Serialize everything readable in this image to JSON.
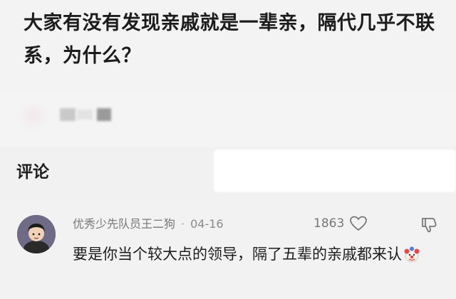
{
  "post": {
    "title": "大家有没有发现亲戚就是一辈亲，隔代几乎不联系，为什么？"
  },
  "comments_section": {
    "heading": "评论"
  },
  "comment": {
    "author": "优秀少先队员王二狗",
    "separator": "·",
    "date": "04-16",
    "likes": "1863",
    "text": "要是你当个较大点的领导，隔了五辈的亲戚都来认",
    "emoji": "clown-face-icon"
  },
  "colors": {
    "background": "#f2f2f2",
    "title_text": "#1c1c1c",
    "meta_text": "#8a8a8a",
    "avatar_bg": "#6f6b86"
  }
}
